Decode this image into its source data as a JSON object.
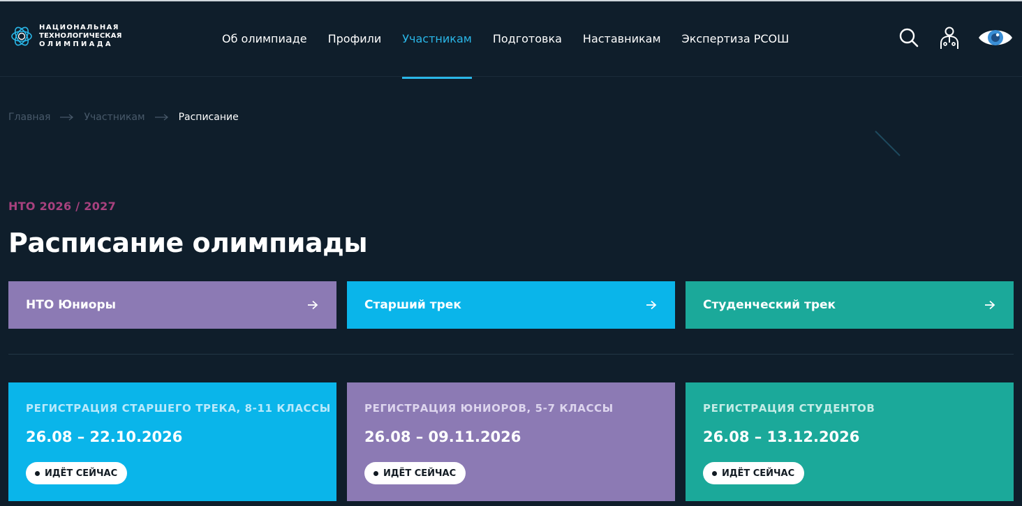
{
  "logo": {
    "lines": [
      "НАЦИОНАЛЬНАЯ",
      "ТЕХНОЛОГИЧЕСКАЯ",
      "ОЛИМПИАДА"
    ]
  },
  "nav": {
    "items": [
      {
        "label": "Об олимпиаде",
        "active": false
      },
      {
        "label": "Профили",
        "active": false
      },
      {
        "label": "Участникам",
        "active": true
      },
      {
        "label": "Подготовка",
        "active": false
      },
      {
        "label": "Наставникам",
        "active": false
      },
      {
        "label": "Экспертиза РСОШ",
        "active": false
      }
    ],
    "icons": [
      "search-icon",
      "user-icon",
      "eye-icon"
    ],
    "accent": "#2ab7e8"
  },
  "breadcrumb": {
    "items": [
      "Главная",
      "Участникам",
      "Расписание"
    ]
  },
  "season": "НТО 2026 / 2027",
  "title": "Расписание олимпиады",
  "tracks": [
    {
      "label": "НТО Юниоры",
      "color": "#8c7ab4"
    },
    {
      "label": "Старший трек",
      "color": "#0ab5ea"
    },
    {
      "label": "Студенческий трек",
      "color": "#1ba99a"
    }
  ],
  "cards": [
    {
      "label": "РЕГИСТРАЦИЯ СТАРШЕГО ТРЕКА, 8-11 КЛАССЫ",
      "dates": "26.08 – 22.10.2026",
      "status": "ИДЁТ СЕЙЧАС",
      "color": "#0ab5ea",
      "label_color": "#b9e9fb"
    },
    {
      "label": "РЕГИСТРАЦИЯ ЮНИОРОВ, 5-7 КЛАССЫ",
      "dates": "26.08 – 09.11.2026",
      "status": "ИДЁТ СЕЙЧАС",
      "color": "#8c7ab4",
      "label_color": "#ddd5ee"
    },
    {
      "label": "РЕГИСТРАЦИЯ СТУДЕНТОВ",
      "dates": "26.08 – 13.12.2026",
      "status": "ИДЁТ СЕЙЧАС",
      "color": "#1ba99a",
      "label_color": "#c4ece6"
    }
  ],
  "colors": {
    "background": "#0f1e2b",
    "season": "#a8417e"
  }
}
